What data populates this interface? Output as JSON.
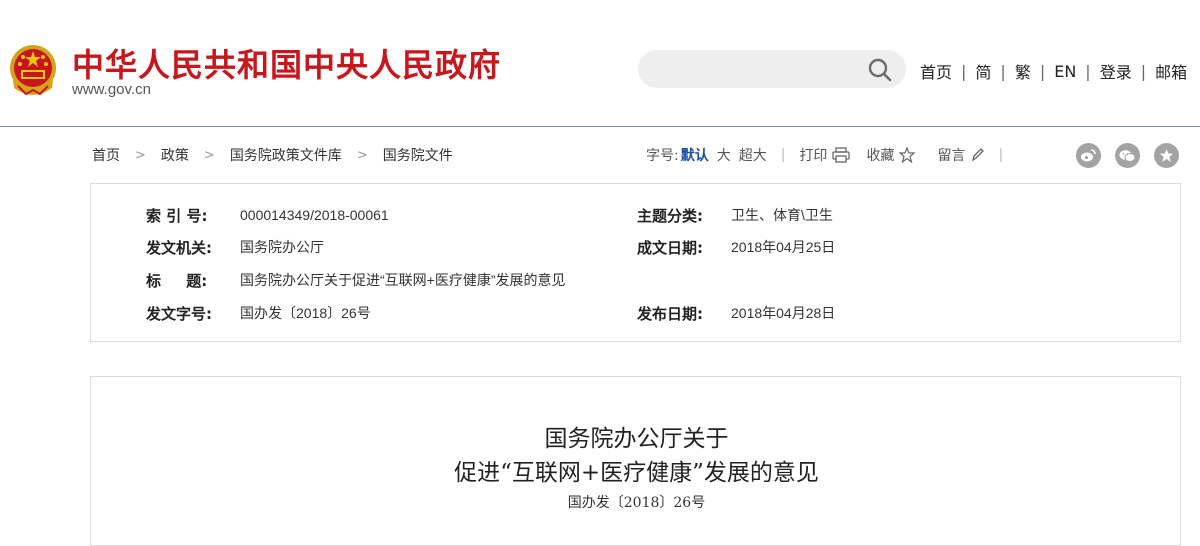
{
  "header": {
    "site_name": "中华人民共和国中央人民政府",
    "site_url": "www.gov.cn",
    "search_placeholder": "",
    "nav": [
      "首页",
      "简",
      "繁",
      "EN",
      "登录",
      "邮箱"
    ]
  },
  "breadcrumb": [
    "首页",
    "政策",
    "国务院政策文件库",
    "国务院文件"
  ],
  "tools": {
    "font_size_label": "字号:",
    "font_sizes": [
      "默认",
      "大",
      "超大"
    ],
    "active_font_size": "默认",
    "print": "打印",
    "favorite": "收藏",
    "comment": "留言"
  },
  "share_icons": [
    "weibo-icon",
    "wechat-icon",
    "star-icon"
  ],
  "info": {
    "index_no": {
      "label": "索 引 号:",
      "value": "000014349/2018-00061"
    },
    "category": {
      "label": "主题分类:",
      "value": "卫生、体育\\卫生"
    },
    "issuer": {
      "label": "发文机关:",
      "value": "国务院办公厅"
    },
    "written_date": {
      "label": "成文日期:",
      "value": "2018年04月25日"
    },
    "title": {
      "label": "标 题:",
      "value": "国务院办公厅关于促进“互联网+医疗健康”发展的意见"
    },
    "doc_no": {
      "label": "发文字号:",
      "value": "国办发〔2018〕26号"
    },
    "publish_date": {
      "label": "发布日期:",
      "value": "2018年04月28日"
    }
  },
  "document": {
    "title_line1": "国务院办公厅关于",
    "title_line2": "促进“互联网+医疗健康”发展的意见",
    "doc_number": "国办发〔2018〕26号"
  },
  "colors": {
    "brand_red": "#c8161d",
    "active_blue": "#1b4f9c",
    "share_grey": "#a3a3a3"
  }
}
